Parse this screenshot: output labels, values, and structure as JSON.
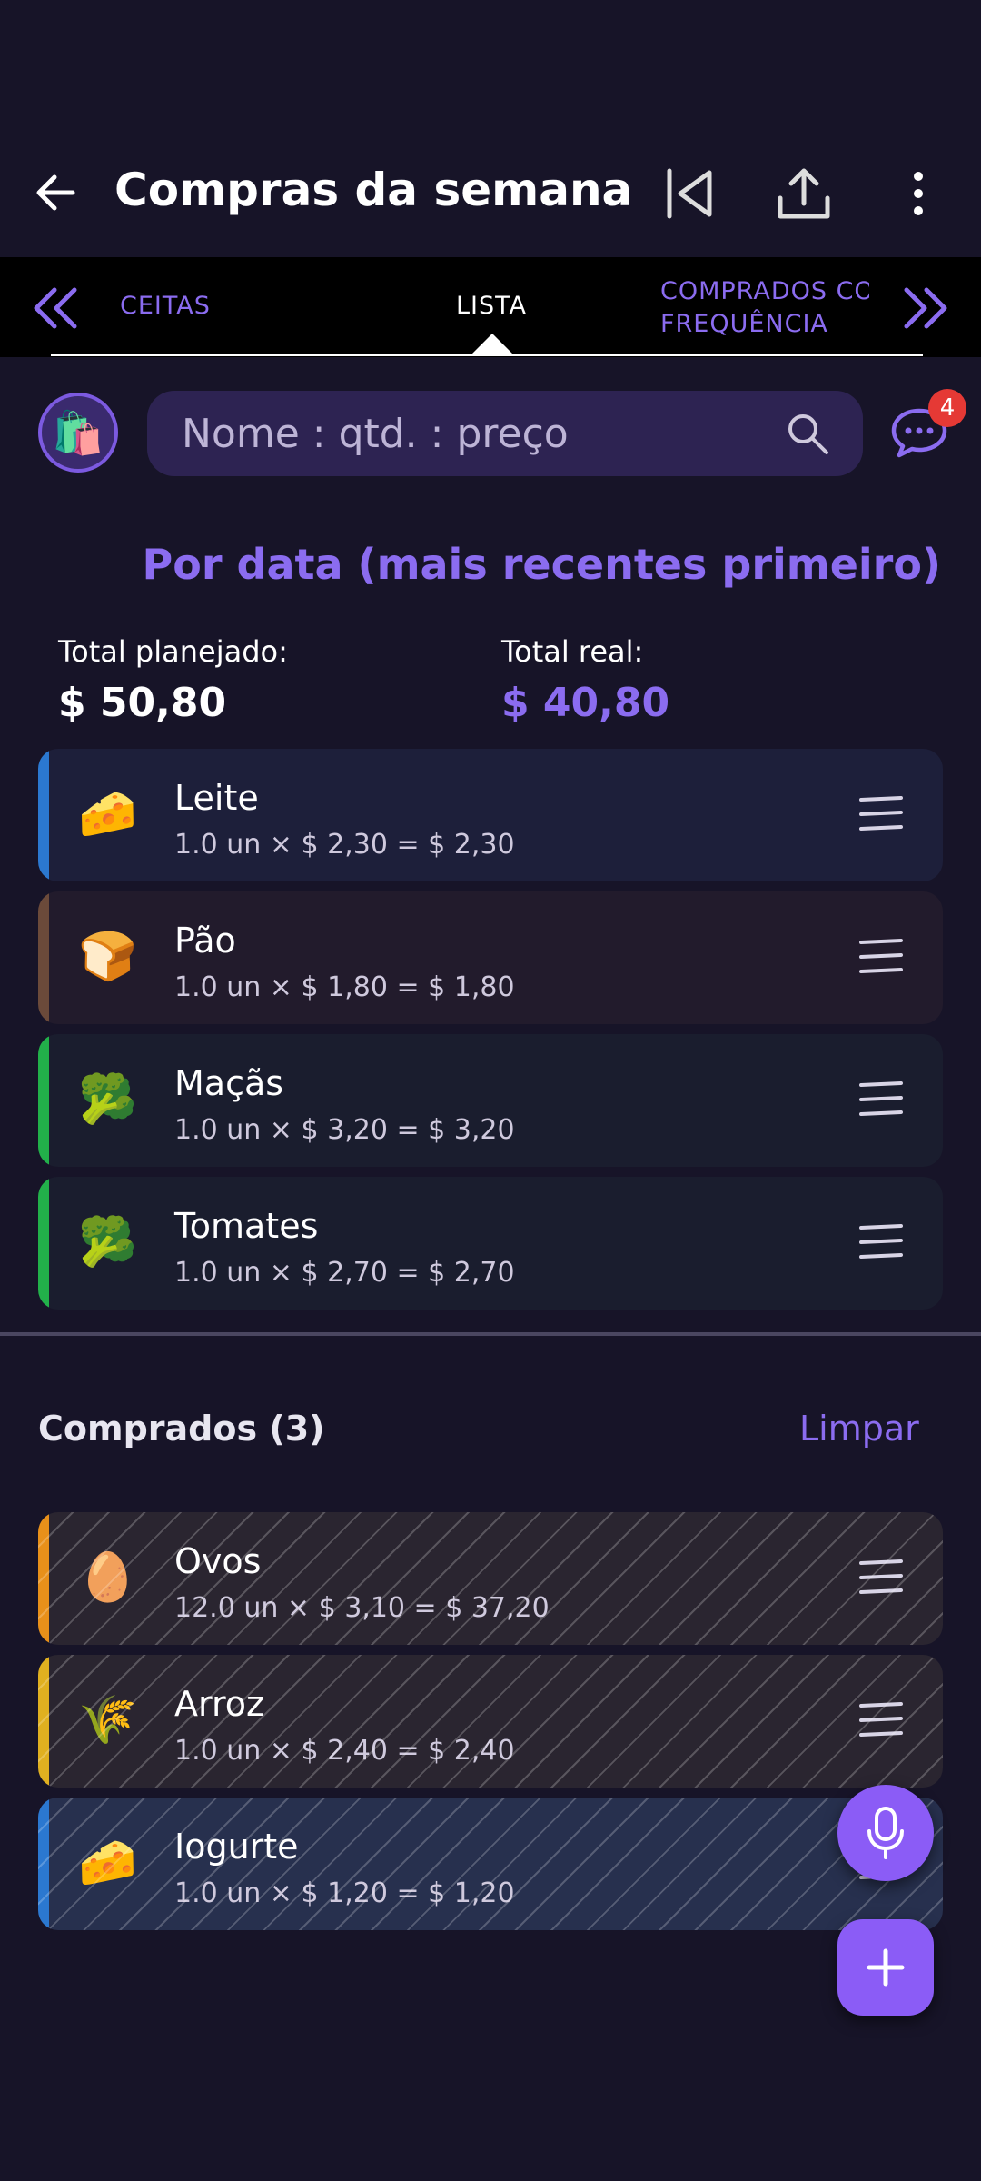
{
  "toolbar": {
    "title": "Compras da semana"
  },
  "tabs": {
    "left_label": "CEITAS",
    "center_label": "LISTA",
    "right_label_line1": "COMPRADOS CO",
    "right_label_line2": "FREQUÊNCIA"
  },
  "search": {
    "placeholder": "Nome : qtd. : preço"
  },
  "chat": {
    "badge_count": "4"
  },
  "sort_label": "Por data (mais recentes primeiro)",
  "totals": {
    "planned_label": "Total planejado:",
    "planned_value": "$ 50,80",
    "real_label": "Total real:",
    "real_value": "$ 40,80"
  },
  "pending_items": [
    {
      "name": "Leite",
      "detail": "1.0 un × $ 2,30 = $ 2,30",
      "icon": "cheese-icon",
      "emoji": "🧀",
      "strip": "#2b78d0",
      "bg": "#1d1f3a"
    },
    {
      "name": "Pão",
      "detail": "1.0 un × $ 1,80 = $ 1,80",
      "icon": "bread-icon",
      "emoji": "🍞",
      "strip": "#6b4a3a",
      "bg": "#221b2c"
    },
    {
      "name": "Maçãs",
      "detail": "1.0 un × $ 3,20 = $ 3,20",
      "icon": "broccoli-icon",
      "emoji": "🥦",
      "strip": "#22b04a",
      "bg": "#1a1d2e"
    },
    {
      "name": "Tomates",
      "detail": "1.0 un × $ 2,70 = $ 2,70",
      "icon": "broccoli-icon",
      "emoji": "🥦",
      "strip": "#22b04a",
      "bg": "#1a1d2e"
    }
  ],
  "purchased": {
    "title": "Comprados (3)",
    "clear_label": "Limpar",
    "items": [
      {
        "name": "Ovos",
        "detail": "12.0 un × $ 3,10 = $ 37,20",
        "icon": "egg-icon",
        "emoji": "🥚",
        "strip": "#e8901a",
        "bg": "#2a2530"
      },
      {
        "name": "Arroz",
        "detail": "1.0 un × $ 2,40 = $ 2,40",
        "icon": "rice-icon",
        "emoji": "🌾",
        "strip": "#e0b020",
        "bg": "#2a2530"
      },
      {
        "name": "Iogurte",
        "detail": "1.0 un × $ 1,20 = $ 1,20",
        "icon": "cheese-icon",
        "emoji": "🧀",
        "strip": "#2b78d0",
        "bg": "#27304e"
      }
    ]
  },
  "colors": {
    "accent": "#8b6cf0",
    "background": "#171428"
  }
}
